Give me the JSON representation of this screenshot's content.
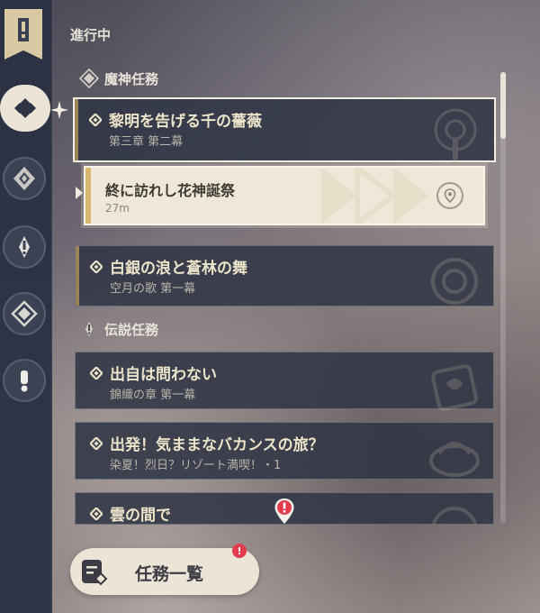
{
  "header": {
    "title": "進行中"
  },
  "categories": {
    "archon": {
      "label": "魔神任務"
    },
    "legend": {
      "label": "伝説任務"
    }
  },
  "quests": [
    {
      "title": "黎明を告げる千の薔薇",
      "subtitle": "第三章 第二幕",
      "selected": true
    },
    {
      "title": "白銀の浪と蒼林の舞",
      "subtitle": "空月の歌 第一幕"
    },
    {
      "title": "出自は問わない",
      "subtitle": "錦織の章 第一幕"
    },
    {
      "title": "出発！気ままなバカンスの旅？",
      "subtitle": "染夏！烈日？リゾート満喫！・1"
    },
    {
      "title": "雲の間で",
      "subtitle": ""
    }
  ],
  "objective": {
    "title": "終に訪れし花神誕祭",
    "distance": "27m"
  },
  "footer": {
    "quest_list_label": "任務一覧",
    "badge": "!"
  },
  "colors": {
    "accent_gold": "#9a8457",
    "panel": "#303544",
    "light_panel": "#efe8d9",
    "alert_red": "#e23b4d"
  },
  "icons": {
    "sidebar": [
      "bookmark-icon",
      "archon-quest-icon",
      "story-quest-icon",
      "legend-quest-icon",
      "world-quest-icon",
      "commission-icon"
    ],
    "objective": "map-pin-icon",
    "footer": "quest-list-icon"
  }
}
